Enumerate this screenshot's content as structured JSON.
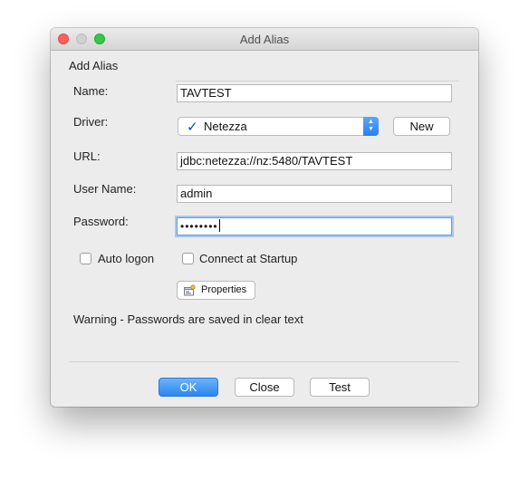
{
  "window": {
    "title": "Add Alias"
  },
  "form": {
    "section_title": "Add Alias",
    "name_label": "Name:",
    "name_value": "TAVTEST",
    "driver_label": "Driver:",
    "driver_value": "Netezza",
    "new_button": "New",
    "url_label": "URL:",
    "url_value": "jdbc:netezza://nz:5480/TAVTEST",
    "username_label": "User Name:",
    "username_value": "admin",
    "password_label": "Password:",
    "password_masked": "••••••••",
    "auto_logon_label": "Auto logon",
    "connect_startup_label": "Connect at Startup",
    "properties_button": "Properties",
    "warning_text": "Warning - Passwords are saved in clear text"
  },
  "footer": {
    "ok_button": "OK",
    "close_button": "Close",
    "test_button": "Test"
  },
  "colors": {
    "accent": "#2b86f0",
    "checkmark": "#1d3fa8",
    "window_bg": "#ececec"
  },
  "icons": {
    "driver_status": "checkmark-icon",
    "select_arrows": "updown-chevron-icon",
    "properties": "properties-icon"
  }
}
